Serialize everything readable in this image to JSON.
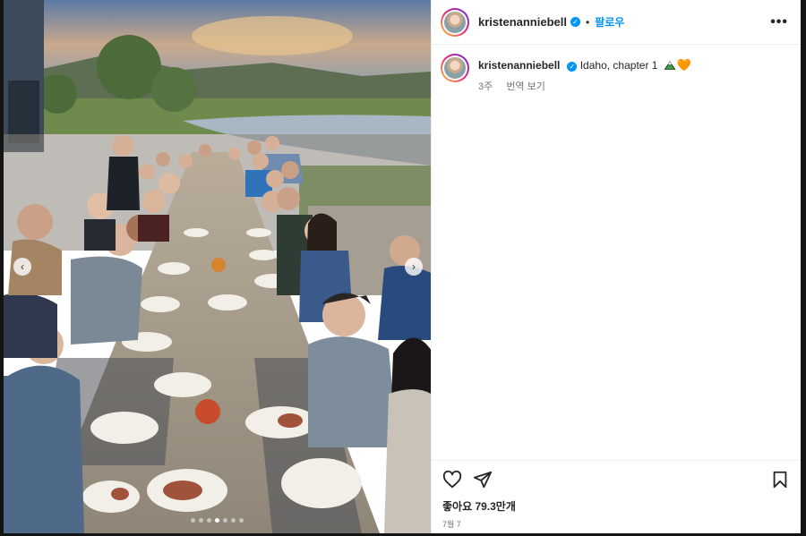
{
  "post": {
    "username": "kristenanniebell",
    "verified_mark": "✓",
    "separator": "•",
    "follow_label": "팔로우",
    "more_label": "•••",
    "caption": "Idaho, chapter 1",
    "caption_emoji_heart": "🧡",
    "time_ago": "3주",
    "translate_label": "번역 보기",
    "likes_text": "좋아요 79.3만개",
    "date": "7월 7"
  },
  "carousel": {
    "prev_label": "‹",
    "next_label": "›",
    "slide_count": 7,
    "active_slide": 3
  },
  "icons": {
    "like": "heart-icon",
    "share": "paper-plane-icon",
    "save": "bookmark-icon",
    "more": "more-options-icon"
  },
  "colors": {
    "link": "#0095f6",
    "text": "#262626",
    "muted": "#737373"
  }
}
